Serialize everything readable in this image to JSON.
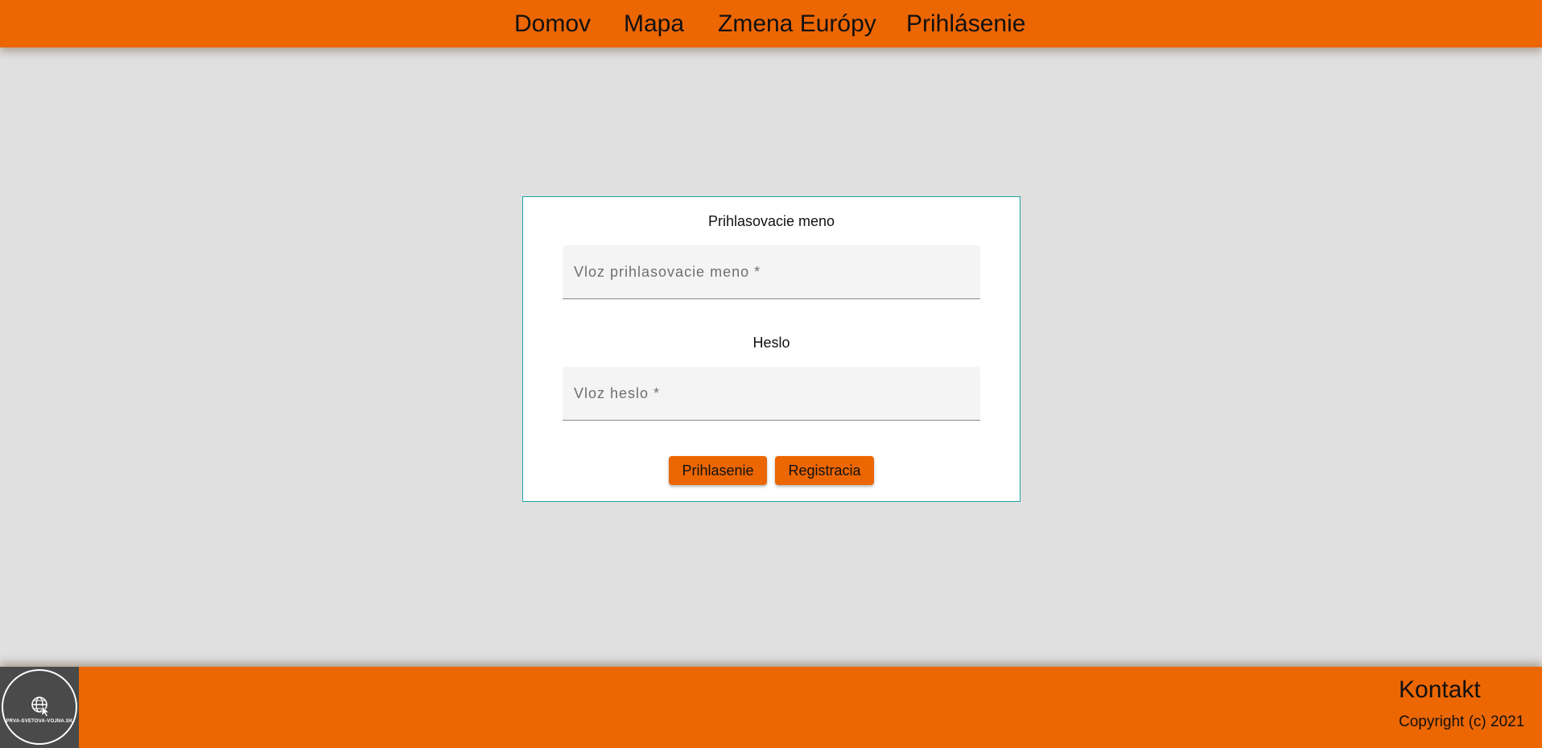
{
  "nav": {
    "items": [
      {
        "label": "Domov"
      },
      {
        "label": "Mapa"
      },
      {
        "label": "Zmena Európy"
      },
      {
        "label": "Prihlásenie"
      }
    ]
  },
  "login_form": {
    "username_label": "Prihlasovacie meno",
    "username_placeholder": "Vloz prihlasovacie meno *",
    "username_value": "",
    "password_label": "Heslo",
    "password_placeholder": "Vloz heslo *",
    "password_value": "",
    "login_button": "Prihlasenie",
    "register_button": "Registracia"
  },
  "footer": {
    "logo_text": "PRVA-SVETOVA-VOJNA.SK",
    "logo_icon": "globe-cursor-icon",
    "contact_label": "Kontakt",
    "copyright": "Copyright (c) 2021"
  },
  "colors": {
    "accent": "#ec6602",
    "background": "#e0e0e0",
    "card_border": "#1fa3a3",
    "logo_background": "#4a4a4a"
  }
}
